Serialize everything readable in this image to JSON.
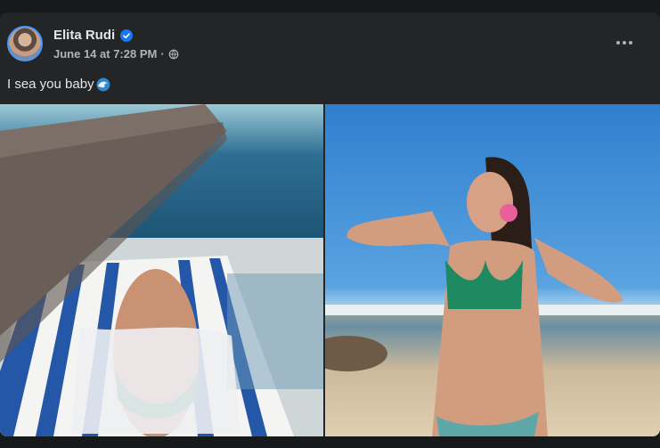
{
  "post": {
    "author": "Elita Rudi",
    "verified": true,
    "timestamp": "June 14 at 7:28 PM",
    "separator": "·",
    "audience_icon": "globe-icon",
    "caption": "I sea you baby",
    "caption_emoji": "water-wave-icon"
  },
  "photos": [
    {
      "alt": "Woman in green bikini lying on striped towel by pool"
    },
    {
      "alt": "Woman in green bikini on beach holding flower over eye"
    }
  ],
  "colors": {
    "background": "#18191a",
    "card": "#242526",
    "text_primary": "#e4e6eb",
    "text_secondary": "#b0b3b8",
    "verified": "#1877f2"
  }
}
